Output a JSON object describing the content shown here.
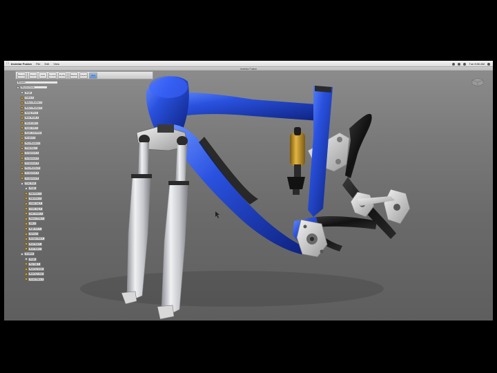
{
  "menubar": {
    "apple": "",
    "items": [
      "Inventor Fusion",
      "File",
      "Edit",
      "View"
    ],
    "clock": "Tue 8:56 AM"
  },
  "window": {
    "title": "Inventor Fusion"
  },
  "ribbon": {
    "tools": [
      "Selection",
      "Sketch",
      "Solid",
      "Construction",
      "Modify",
      "Measure",
      "Inspect",
      "View"
    ]
  },
  "browser": {
    "root": "Browser",
    "assembly": "Bicycle Frame",
    "items": [
      {
        "label": "Origin",
        "depth": 1,
        "kind": "grp"
      },
      {
        "label": "Frame 1",
        "depth": 1
      },
      {
        "label": "Bottom Bracket 1",
        "depth": 1
      },
      {
        "label": "Bottom Bracket 2",
        "depth": 1
      },
      {
        "label": "Swing Arm 1",
        "depth": 1
      },
      {
        "label": "Rear Shock 1",
        "depth": 1
      },
      {
        "label": "Shock Link 1",
        "depth": 1
      },
      {
        "label": "Upper Link 1",
        "depth": 1
      },
      {
        "label": "Upper Link Pivot",
        "depth": 1
      },
      {
        "label": "Dropout 1",
        "depth": 1
      },
      {
        "label": "Pivot Bracket 1",
        "depth": 1
      },
      {
        "label": "Chainstay 1",
        "depth": 1
      },
      {
        "label": "Component 1",
        "depth": 1
      },
      {
        "label": "Component 2",
        "depth": 1
      },
      {
        "label": "Component 3",
        "depth": 1
      },
      {
        "label": "Pivot Bracket 2",
        "depth": 1
      },
      {
        "label": "Component 4",
        "depth": 1
      },
      {
        "label": "Component 5",
        "depth": 1
      },
      {
        "label": "Front Fork",
        "depth": 1,
        "kind": "grp"
      },
      {
        "label": "Origin",
        "depth": 2,
        "kind": "grp"
      },
      {
        "label": "Stanchion 1",
        "depth": 2
      },
      {
        "label": "Stanchion 2",
        "depth": 2
      },
      {
        "label": "Lower Leg 1",
        "depth": 2
      },
      {
        "label": "Lower Leg 2",
        "depth": 2
      },
      {
        "label": "Fork Crown 1",
        "depth": 2
      },
      {
        "label": "Steerer Tube 1",
        "depth": 2
      },
      {
        "label": "Axle 1",
        "depth": 2
      },
      {
        "label": "Right Arm 1",
        "depth": 2
      },
      {
        "label": "Spring 1",
        "depth": 2
      },
      {
        "label": "Damper Rod 1",
        "depth": 2
      },
      {
        "label": "Dust Seal 1",
        "depth": 2
      },
      {
        "label": "Dust Seal 2",
        "depth": 2
      },
      {
        "label": "Headset",
        "depth": 1,
        "kind": "grp"
      },
      {
        "label": "Origin",
        "depth": 2,
        "kind": "grp"
      },
      {
        "label": "Top Cap 1",
        "depth": 2
      },
      {
        "label": "Bearing Upper",
        "depth": 2
      },
      {
        "label": "Bearing Lower",
        "depth": 2
      },
      {
        "label": "Crown Race 1",
        "depth": 2
      }
    ]
  },
  "colors": {
    "frame": "#1d3fc4",
    "frame_highlight": "#5d86ff",
    "fork_silver": "#c9cbcf",
    "shock_gold": "#c79a2a",
    "carbon": "#1a1a1a",
    "viewport_top": "#8e8e8e",
    "viewport_bottom": "#5e5e5e"
  }
}
